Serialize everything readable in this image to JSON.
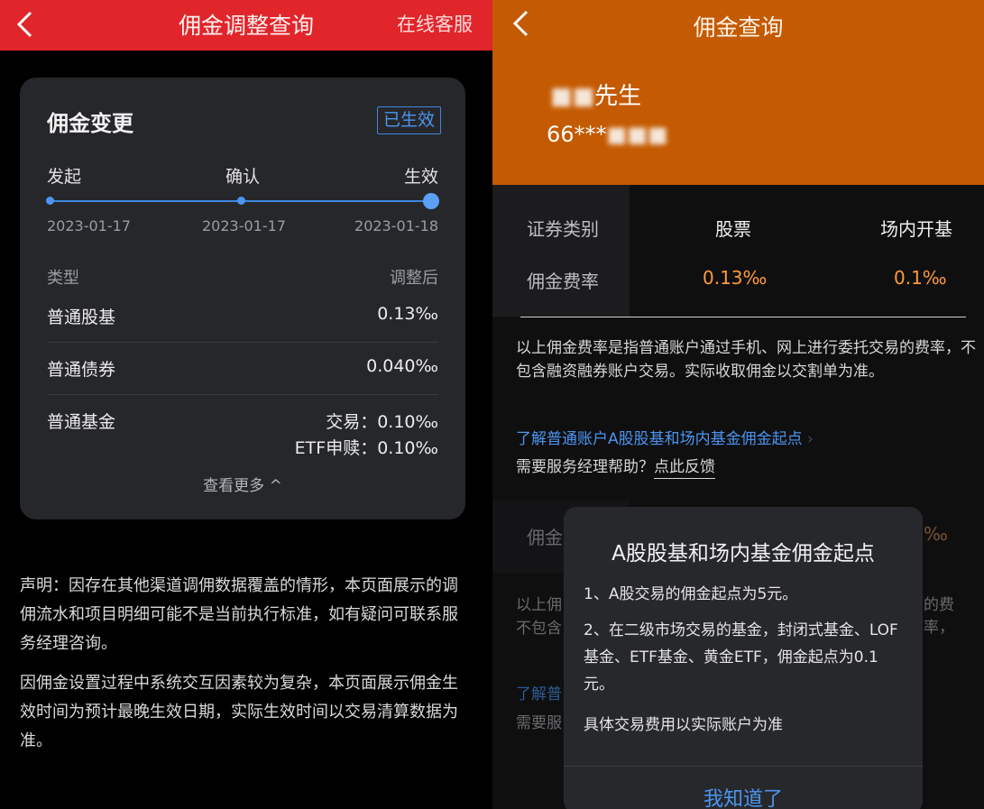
{
  "left": {
    "header": {
      "title": "佣金调整查询",
      "service": "在线客服"
    },
    "card": {
      "title": "佣金变更",
      "badge": "已生效",
      "steps": [
        {
          "label": "发起",
          "date": "2023-01-17"
        },
        {
          "label": "确认",
          "date": "2023-01-17"
        },
        {
          "label": "生效",
          "date": "2023-01-18"
        }
      ],
      "col_type": "类型",
      "col_after": "调整后",
      "rows": [
        {
          "label": "普通股基",
          "value": "0.13‰"
        },
        {
          "label": "普通债券",
          "value": "0.040‰"
        },
        {
          "label": "普通基金",
          "value": "交易：0.10‰",
          "value2": "ETF申赎：0.10‰"
        }
      ],
      "more": "查看更多 ^"
    },
    "notes": [
      "声明：因存在其他渠道调佣数据覆盖的情形，本页面展示的调佣流水和项目明细可能不是当前执行标准，如有疑问可联系服务经理咨询。",
      "因佣金设置过程中系统交互因素较为复杂，本页面展示佣金生效时间为预计最晚生效日期，实际生效时间以交易清算数据为准。"
    ]
  },
  "right": {
    "header": {
      "title": "佣金查询",
      "name_visible": "先生",
      "account_visible": "66***"
    },
    "table": {
      "row1": [
        "证券类别",
        "股票",
        "场内开基"
      ],
      "row2": [
        "佣金费率",
        "0.13‰",
        "0.1‰"
      ]
    },
    "note": "以上佣金费率是指普通账户通过手机、网上进行委托交易的费率，不包含融资融券账户交易。实际收取佣金以交割单为准。",
    "link": "了解普通账户A股股基和场内基金佣金起点",
    "help": {
      "prefix": "需要服务经理帮助？",
      "action": "点此反馈"
    },
    "dialog": {
      "title": "A股股基和场内基金佣金起点",
      "line1": "1、A股交易的佣金起点为5元。",
      "line2": "2、在二级市场交易的基金，封闭式基金、LOF基金、ETF基金、黄金ETF，佣金起点为0.1元。",
      "line3": "具体交易费用以实际账户为准",
      "ok": "我知道了"
    }
  },
  "colors": {
    "left_header": "#e0262b",
    "right_header": "#c45a02",
    "accent_blue": "#4b95f0",
    "rate_orange": "#ff9a3c"
  },
  "icons": {
    "back": "chevron-left-icon",
    "link_arrow": "chevron-right-icon"
  }
}
